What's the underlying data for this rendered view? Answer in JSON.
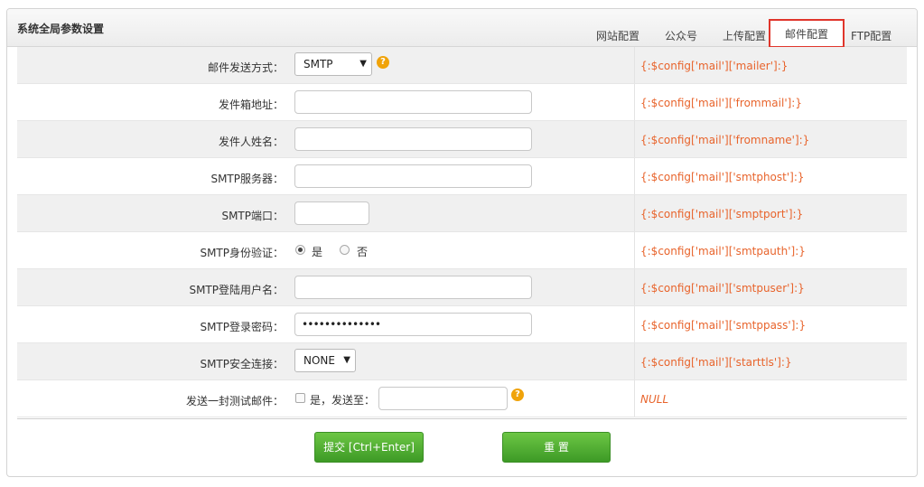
{
  "panel": {
    "title": "系统全局参数设置"
  },
  "tabs": [
    {
      "label": "网站配置"
    },
    {
      "label": "公众号"
    },
    {
      "label": "上传配置"
    },
    {
      "label": "邮件配置"
    },
    {
      "label": "FTP配置"
    }
  ],
  "active_tab": "邮件配置",
  "rows": {
    "mailer": {
      "label": "邮件发送方式：",
      "value": "SMTP",
      "code": "{:$config['mail']['mailer']:}"
    },
    "frommail": {
      "label": "发件箱地址：",
      "value": "",
      "code": "{:$config['mail']['frommail']:}"
    },
    "fromname": {
      "label": "发件人姓名：",
      "value": "",
      "code": "{:$config['mail']['fromname']:}"
    },
    "smtphost": {
      "label": "SMTP服务器：",
      "value": "",
      "code": "{:$config['mail']['smtphost']:}"
    },
    "smtpport": {
      "label": "SMTP端口：",
      "value": "",
      "code": "{:$config['mail']['smptport']:}"
    },
    "smtpauth": {
      "label": "SMTP身份验证：",
      "option_yes": "是",
      "option_no": "否",
      "selected": "是",
      "code": "{:$config['mail']['smtpauth']:}"
    },
    "smtpuser": {
      "label": "SMTP登陆用户名：",
      "value": "",
      "code": "{:$config['mail']['smtpuser']:}"
    },
    "smtppass": {
      "label": "SMTP登录密码：",
      "value": "••••••••••••••",
      "code": "{:$config['mail']['smtppass']:}"
    },
    "starttls": {
      "label": "SMTP安全连接：",
      "value": "NONE",
      "code": "{:$config['mail']['starttls']:}"
    },
    "testmail": {
      "label": "发送一封测试邮件：",
      "checkbox_label": "是，发送至：",
      "value": "",
      "code": "NULL"
    }
  },
  "buttons": {
    "submit": "提交 [Ctrl+Enter]",
    "reset": "重 置"
  },
  "colors": {
    "code_text": "#e8642c",
    "button_green": "#4fb233",
    "active_tab_border": "#e0352b",
    "help_icon": "#f0a30a"
  },
  "icons": {
    "help": "help-icon",
    "dropdown": "chevron-down-icon"
  }
}
